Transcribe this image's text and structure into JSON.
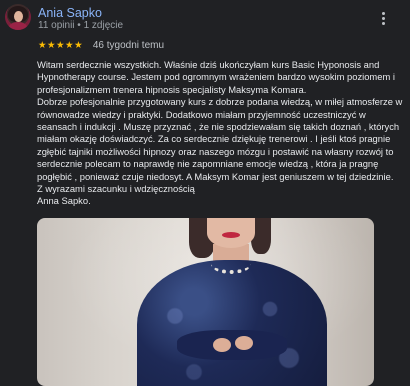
{
  "reviewer": {
    "name": "Ania Sapko",
    "meta": "11 opinii • 1 zdjęcie"
  },
  "review": {
    "stars": "★★★★★",
    "rating": 5,
    "time": "46 tygodni temu",
    "paragraphs": [
      "Witam serdecznie wszystkich. Właśnie dziś ukończyłam kurs Basic Hyponosis and Hypnotherapy course. Jestem pod ogromnym wrażeniem bardzo wysokim poziomem i profesjonalizmem trenera hipnosis specjalisty Maksyma Komara.",
      "Dobrze pofesjonalnie przygotowany kurs z dobrze podana wiedzą, w miłej atmosferze w równowadze wiedzy i praktyki. Dodatkowo miałam przyjemność uczestniczyć w seansach i indukcji . Muszę przyznać , że nie spodziewałam się takich doznań , których miałam okazję doświadczyć. Za co serdecznie dziękuję trenerowi . I jeśli ktoś pragnie zgłębić tajniki możliwości hipnozy oraz naszego mózgu i postawić na własny rozwój to serdecznie polecam to naprawdę nie zapomniane emocje wiedzą , która ja pragnę pogłębić , ponieważ czuje niedosyt. A Maksym Komar jest geniuszem w tej dziedzinie.",
      "Z wyrazami szacunku i wdzięcznością",
      "Anna Sapko."
    ]
  },
  "icons": {
    "more": "more-vert-icon",
    "star": "star-icon"
  },
  "colors": {
    "background": "#202124",
    "name": "#8ab4f8",
    "stars": "#fbbc04",
    "text": "#e8eaed",
    "meta": "#9aa0a6"
  }
}
